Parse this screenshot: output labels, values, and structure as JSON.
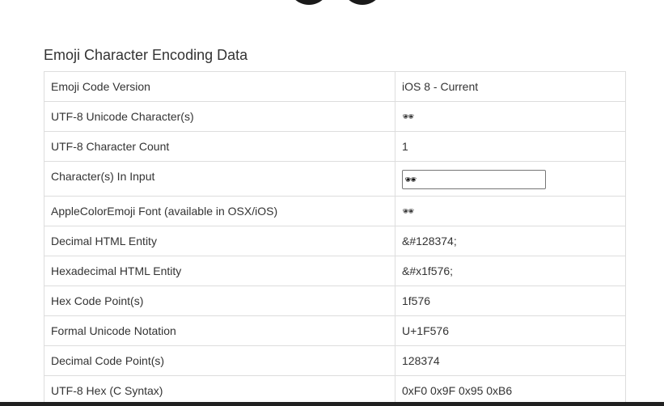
{
  "section": {
    "title": "Emoji Character Encoding Data"
  },
  "hero": {
    "icon": "sunglasses-icon"
  },
  "rows": [
    {
      "label": "Emoji Code Version",
      "value": "iOS 8 - Current"
    },
    {
      "label": "UTF-8 Unicode Character(s)",
      "value": "🕶"
    },
    {
      "label": "UTF-8 Character Count",
      "value": "1"
    },
    {
      "label": "Character(s) In Input",
      "value": "🕶"
    },
    {
      "label": "AppleColorEmoji Font (available in OSX/iOS)",
      "value": "🕶"
    },
    {
      "label": "Decimal HTML Entity",
      "value": "&#128374;"
    },
    {
      "label": "Hexadecimal HTML Entity",
      "value": "&#x1f576;"
    },
    {
      "label": "Hex Code Point(s)",
      "value": "1f576"
    },
    {
      "label": "Formal Unicode Notation",
      "value": "U+1F576"
    },
    {
      "label": "Decimal Code Point(s)",
      "value": "128374"
    },
    {
      "label": "UTF-8 Hex (C Syntax)",
      "value": "0xF0 0x9F 0x95 0xB6"
    }
  ]
}
